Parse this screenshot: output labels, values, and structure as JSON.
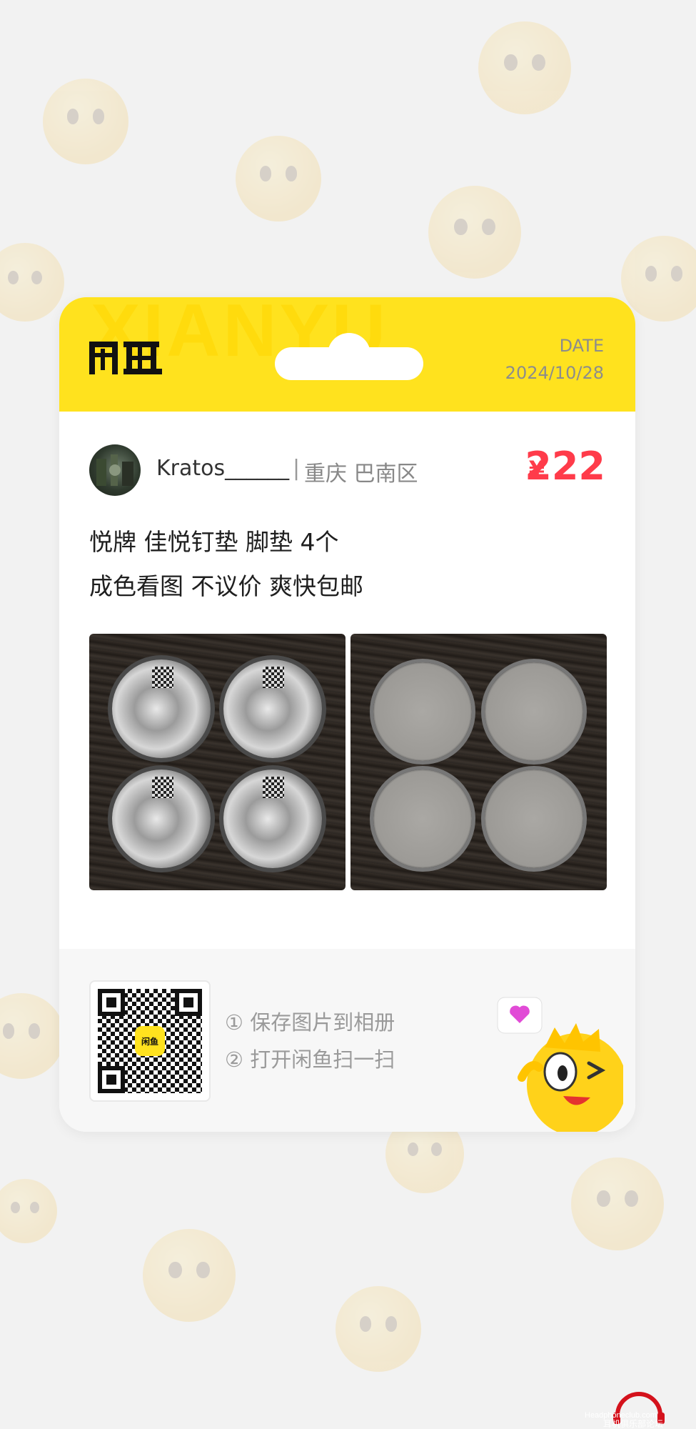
{
  "header": {
    "brand_logo_text": "闲鱼",
    "watermark_text": "XIANYU",
    "date_label": "DATE",
    "date_value": "2024/10/28"
  },
  "seller": {
    "username": "Kratos______",
    "separator": "|",
    "location": "重庆 巴南区"
  },
  "price": {
    "currency": "¥",
    "value": "222"
  },
  "listing": {
    "title_line1": "悦牌 佳悦钉垫 脚垫 4个",
    "title_line2": "成色看图 不议价 爽快包邮"
  },
  "photos": [
    {
      "name": "product-photo-top"
    },
    {
      "name": "product-photo-bottom"
    }
  ],
  "footer": {
    "qr_logo_text": "闲鱼",
    "step1": "① 保存图片到相册",
    "step2": "② 打开闲鱼扫一扫"
  },
  "site_logo": {
    "line1": "Headphoneclub.com",
    "line2": "耳机俱乐部论坛"
  },
  "colors": {
    "brand_yellow": "#ffe21e",
    "price_red": "#ff3b4a",
    "background": "#f2f2f2"
  }
}
